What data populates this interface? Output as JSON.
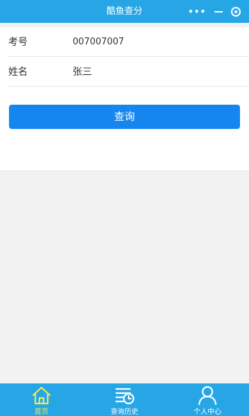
{
  "header": {
    "title": "酷鱼查分",
    "more_icon": "more-icon",
    "minimize_icon": "minimize-icon",
    "close_icon": "record-close-icon"
  },
  "form": {
    "exam_number": {
      "label": "考号",
      "value": "007007007"
    },
    "name": {
      "label": "姓名",
      "value": "张三"
    },
    "submit_label": "查询"
  },
  "tabbar": {
    "items": [
      {
        "label": "首页",
        "icon": "home-icon",
        "active": true
      },
      {
        "label": "查询历史",
        "icon": "history-icon",
        "active": false
      },
      {
        "label": "个人中心",
        "icon": "user-icon",
        "active": false
      }
    ]
  },
  "colors": {
    "nav": "#27a6e6",
    "button": "#1686ef",
    "active_tab": "#f3e94f"
  }
}
